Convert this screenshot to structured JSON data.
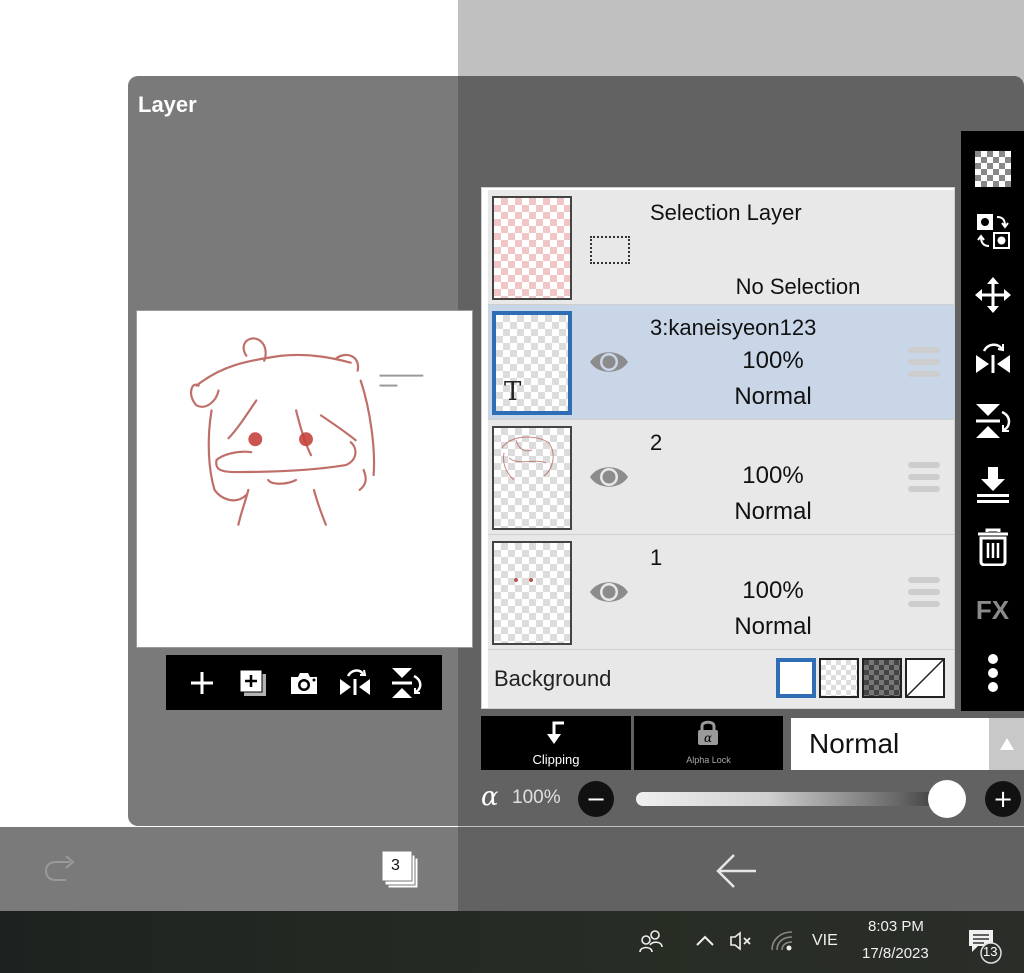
{
  "panel": {
    "title": "Layer"
  },
  "preview_toolbar": {
    "buttons": [
      {
        "icon": "add-layer-icon",
        "label": "Add layer"
      },
      {
        "icon": "duplicate-layer-icon",
        "label": "Add copy layer"
      },
      {
        "icon": "camera-icon",
        "label": "Import photo"
      },
      {
        "icon": "flip-horizontal-icon",
        "label": "Flip horizontal"
      },
      {
        "icon": "flip-vertical-icon",
        "label": "Flip vertical"
      }
    ]
  },
  "layers": {
    "selection_layer": {
      "name": "Selection Layer",
      "status": "No Selection"
    },
    "items": [
      {
        "name": "3:kaneisyeon123",
        "opacity": "100%",
        "mode": "Normal",
        "visible": true,
        "selected": true,
        "type": "text",
        "type_glyph": "T"
      },
      {
        "name": "2",
        "opacity": "100%",
        "mode": "Normal",
        "visible": true,
        "selected": false,
        "type": "raster"
      },
      {
        "name": "1",
        "opacity": "100%",
        "mode": "Normal",
        "visible": true,
        "selected": false,
        "type": "raster"
      }
    ],
    "background": {
      "label": "Background",
      "options": [
        "white",
        "transparent",
        "dark-checker",
        "none"
      ],
      "selected": "white"
    }
  },
  "right_toolbar": {
    "buttons": [
      {
        "icon": "transparency-checker-icon"
      },
      {
        "icon": "swap-layer-icon"
      },
      {
        "icon": "move-icon"
      },
      {
        "icon": "flip-horizontal-icon"
      },
      {
        "icon": "flip-vertical-icon"
      },
      {
        "icon": "merge-down-icon"
      },
      {
        "icon": "trash-icon"
      },
      {
        "icon": "fx-icon",
        "label": "FX"
      },
      {
        "icon": "more-vertical-icon"
      }
    ]
  },
  "controls": {
    "clipping_label": "Clipping",
    "alpha_lock_label": "Alpha Lock",
    "blend_mode": "Normal",
    "alpha_symbol": "α",
    "opacity_label": "100%",
    "opacity_value": 1.0,
    "minus_label": "−",
    "plus_label": "+"
  },
  "navbar": {
    "layer_count": "3"
  },
  "taskbar": {
    "language": "VIE",
    "time": "8:03 PM",
    "date": "17/8/2023",
    "notification_count": "13"
  },
  "colors": {
    "accent": "#2f6db5",
    "selected_row": "#c9d6e8",
    "sketch_line": "#b5574f"
  }
}
